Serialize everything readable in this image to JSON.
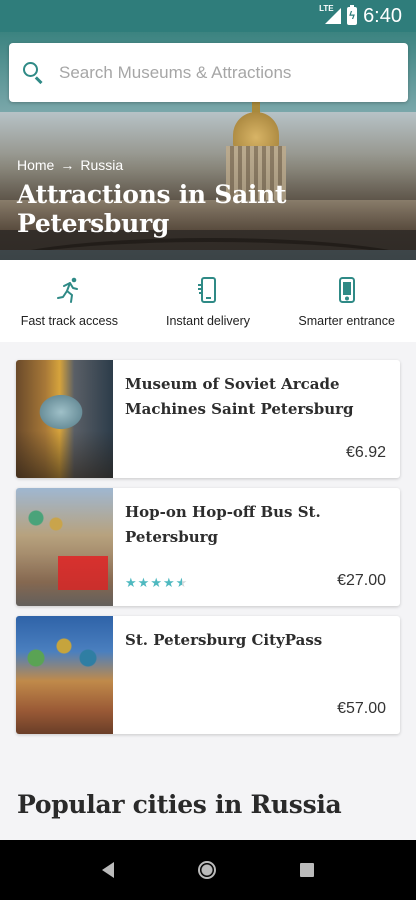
{
  "status_bar": {
    "network": "LTE",
    "time": "6:40"
  },
  "search": {
    "placeholder": "Search Museums & Attractions",
    "value": ""
  },
  "hero": {
    "breadcrumb": [
      "Home",
      "Russia"
    ],
    "title": "Attractions in Saint Petersburg"
  },
  "features": [
    {
      "label": "Fast track access",
      "icon": "running-person-icon"
    },
    {
      "label": "Instant delivery",
      "icon": "phone-delivery-icon"
    },
    {
      "label": "Smarter entrance",
      "icon": "smartphone-icon"
    }
  ],
  "cards": [
    {
      "title": "Museum of Soviet Arcade Machines Saint Petersburg",
      "price": "€6.92",
      "rating": null
    },
    {
      "title": "Hop-on Hop-off Bus St. Petersburg",
      "price": "€27.00",
      "rating": 4.5
    },
    {
      "title": "St. Petersburg CityPass",
      "price": "€57.00",
      "rating": null
    }
  ],
  "popular": {
    "title": "Popular cities in Russia"
  },
  "colors": {
    "accent": "#2f8a86",
    "status_bar": "#2f7d7b",
    "star": "#4fb9c0"
  }
}
